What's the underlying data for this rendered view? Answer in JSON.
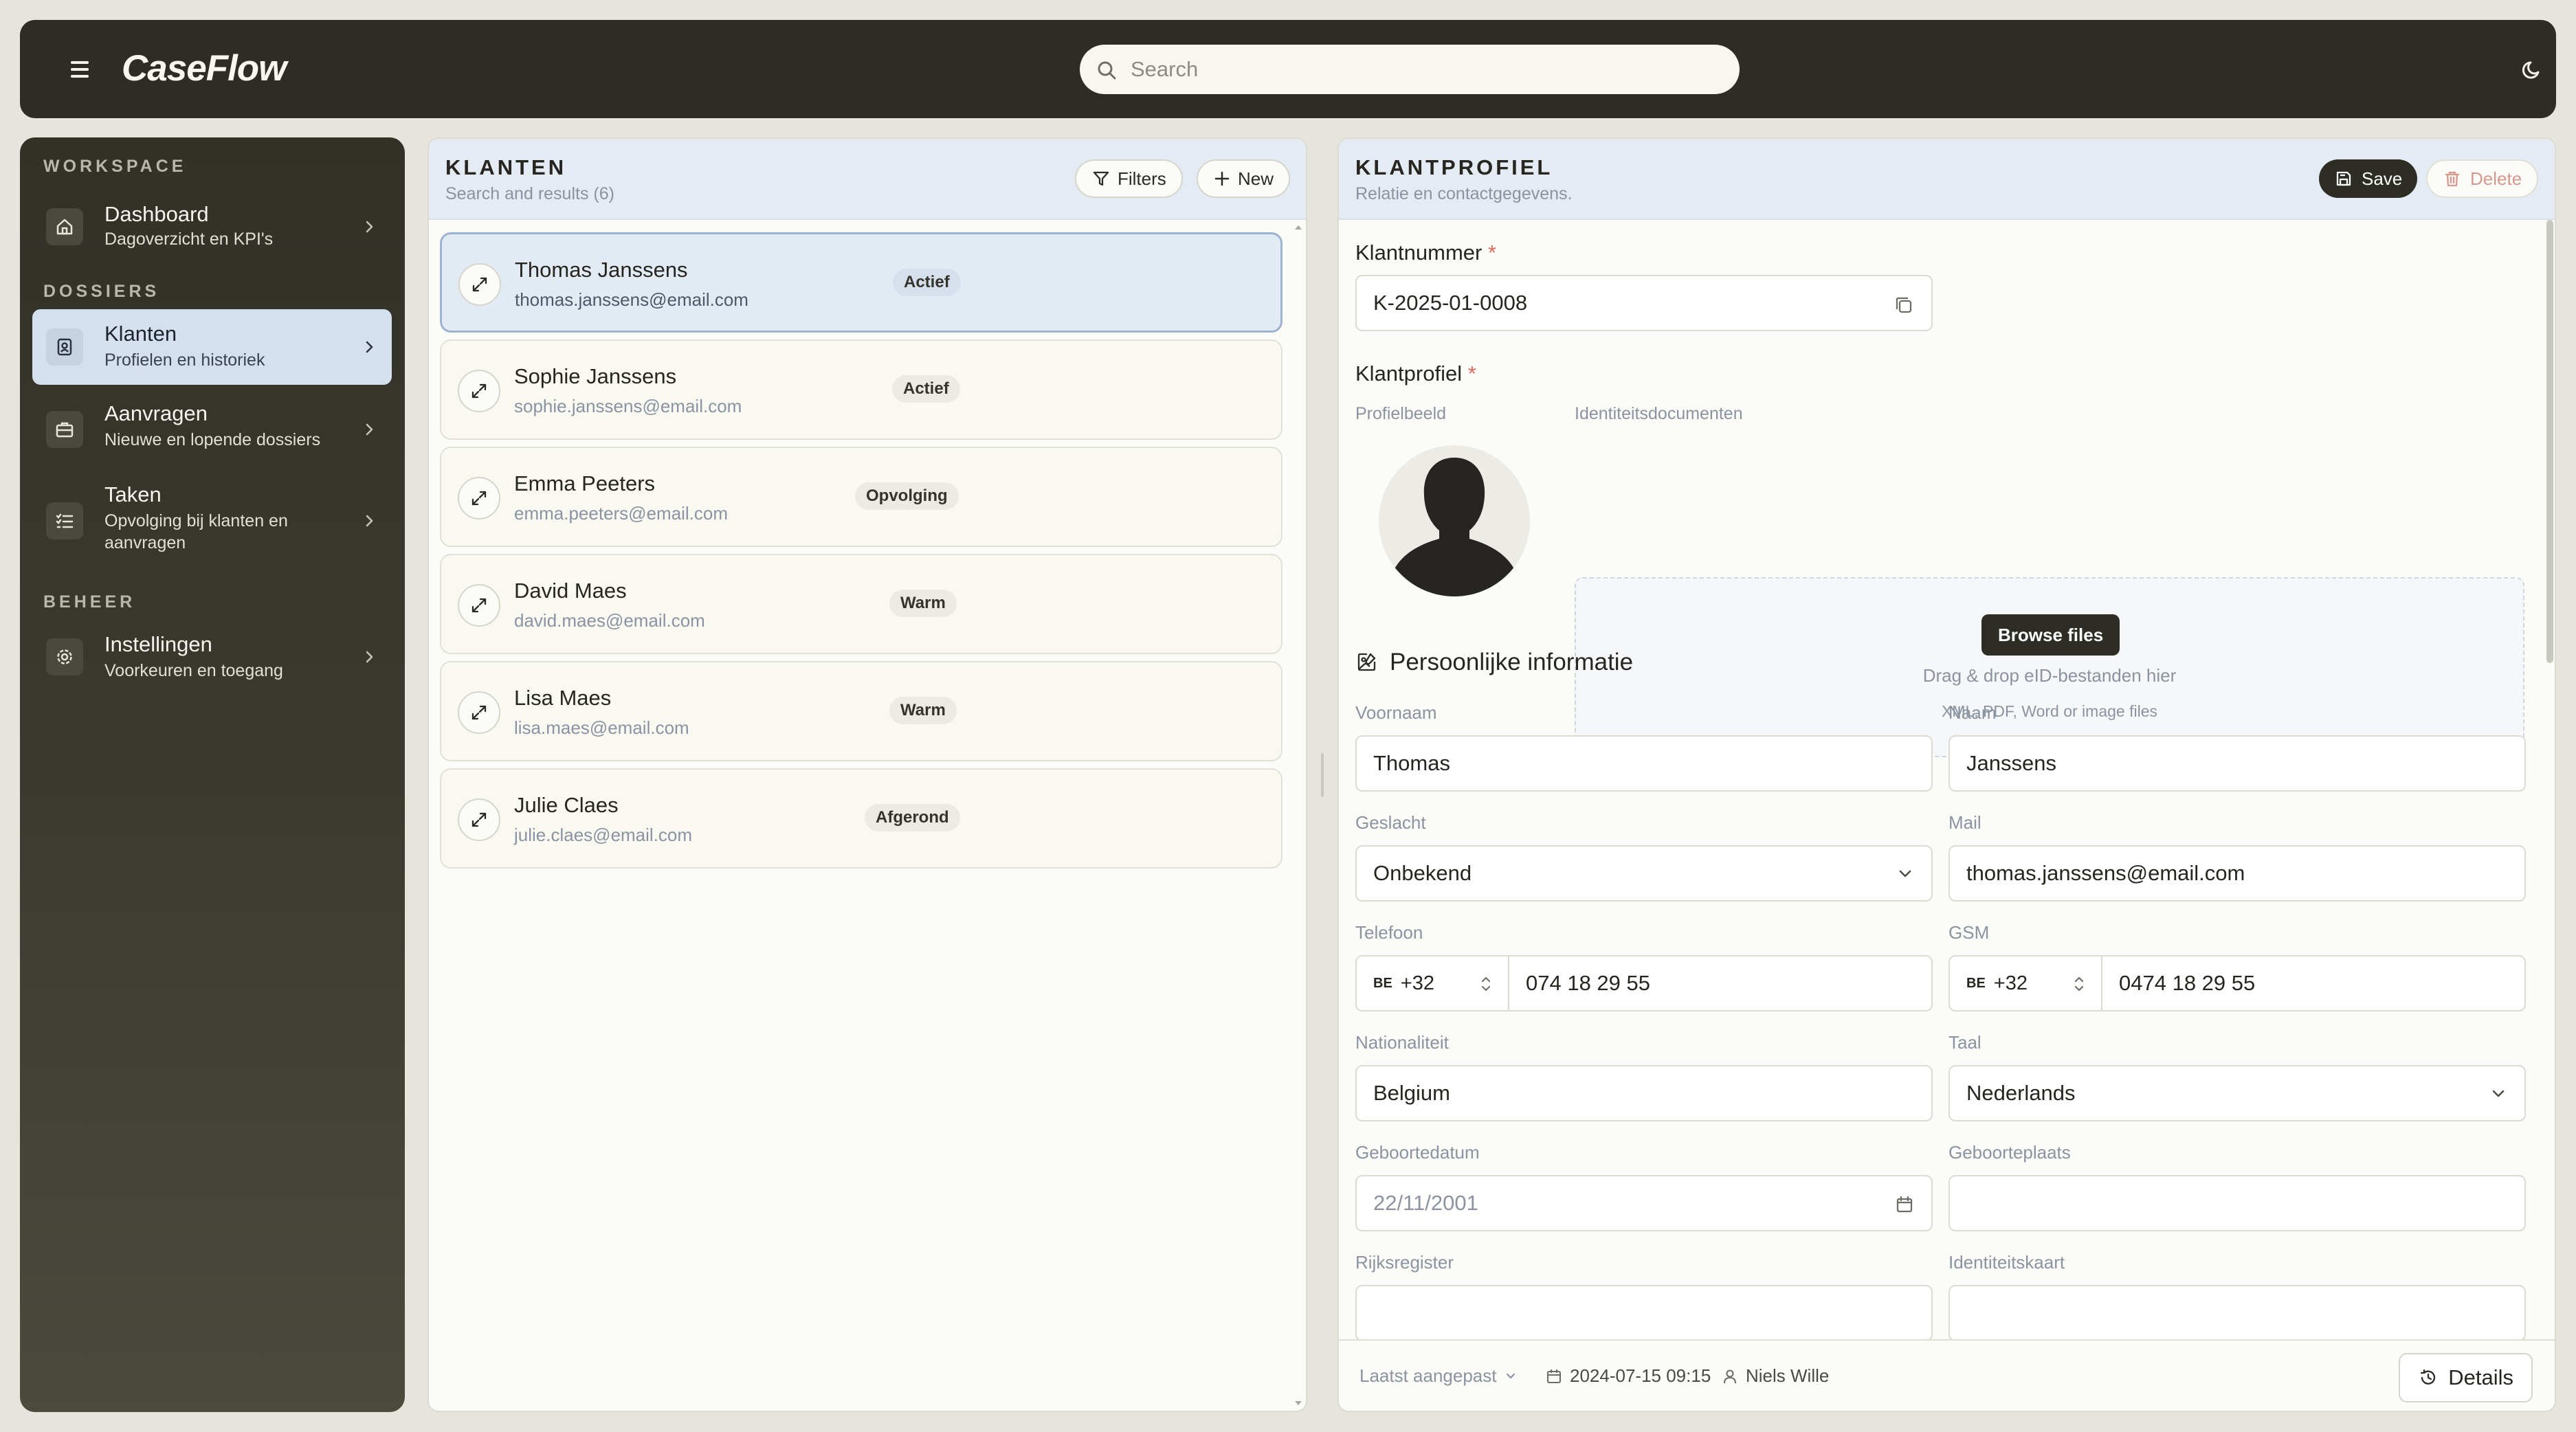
{
  "app": {
    "name": "CaseFlow"
  },
  "search": {
    "placeholder": "Search"
  },
  "sidebar": {
    "sections": [
      {
        "label": "WORKSPACE"
      },
      {
        "label": "DOSSIERS"
      },
      {
        "label": "BEHEER"
      }
    ],
    "items": [
      {
        "title": "Dashboard",
        "subtitle": "Dagoverzicht en KPI's",
        "icon": "home-icon",
        "active": false
      },
      {
        "title": "Klanten",
        "subtitle": "Profielen en historiek",
        "icon": "contact-icon",
        "active": true
      },
      {
        "title": "Aanvragen",
        "subtitle": "Nieuwe en lopende dossiers",
        "icon": "briefcase-icon",
        "active": false
      },
      {
        "title": "Taken",
        "subtitle": "Opvolging bij klanten en aanvragen",
        "icon": "tasks-icon",
        "active": false
      },
      {
        "title": "Instellingen",
        "subtitle": "Voorkeuren en toegang",
        "icon": "gear-icon",
        "active": false
      }
    ]
  },
  "list": {
    "title": "KLANTEN",
    "subtitle": "Search and results (6)",
    "filters_label": "Filters",
    "new_label": "New",
    "customers": [
      {
        "name": "Thomas Janssens",
        "email": "thomas.janssens@email.com",
        "status": "Actief",
        "active": true
      },
      {
        "name": "Sophie Janssens",
        "email": "sophie.janssens@email.com",
        "status": "Actief",
        "active": false
      },
      {
        "name": "Emma Peeters",
        "email": "emma.peeters@email.com",
        "status": "Opvolging",
        "active": false
      },
      {
        "name": "David Maes",
        "email": "david.maes@email.com",
        "status": "Warm",
        "active": false
      },
      {
        "name": "Lisa Maes",
        "email": "lisa.maes@email.com",
        "status": "Warm",
        "active": false
      },
      {
        "name": "Julie Claes",
        "email": "julie.claes@email.com",
        "status": "Afgerond",
        "active": false
      }
    ]
  },
  "profile": {
    "title": "KLANTPROFIEL",
    "subtitle": "Relatie en contactgegevens.",
    "save_label": "Save",
    "delete_label": "Delete",
    "klantnummer_label": "Klantnummer",
    "klantnummer_value": "K-2025-01-0008",
    "klantprofiel_label": "Klantprofiel",
    "profielbeeld_label": "Profielbeeld",
    "identiteit_label": "Identiteitsdocumenten",
    "browse_label": "Browse files",
    "drop_text": "Drag & drop eID-bestanden hier",
    "drop_sub": "XML, PDF, Word or image files",
    "section_title": "Persoonlijke informatie",
    "fields": {
      "voornaam": {
        "label": "Voornaam",
        "value": "Thomas"
      },
      "naam": {
        "label": "Naam",
        "value": "Janssens"
      },
      "geslacht": {
        "label": "Geslacht",
        "value": "Onbekend"
      },
      "mail": {
        "label": "Mail",
        "value": "thomas.janssens@email.com"
      },
      "telefoon": {
        "label": "Telefoon",
        "country": "BE",
        "prefix": "+32",
        "value": "074 18 29 55"
      },
      "gsm": {
        "label": "GSM",
        "country": "BE",
        "prefix": "+32",
        "value": "0474 18 29 55"
      },
      "nationaliteit": {
        "label": "Nationaliteit",
        "value": "Belgium"
      },
      "taal": {
        "label": "Taal",
        "value": "Nederlands"
      },
      "geboortedatum": {
        "label": "Geboortedatum",
        "placeholder": "22/11/2001"
      },
      "geboorteplaats": {
        "label": "Geboorteplaats",
        "value": ""
      },
      "rijksregister": {
        "label": "Rijksregister",
        "value": ""
      },
      "identiteitskaart": {
        "label": "Identiteitskaart",
        "value": ""
      }
    },
    "footer": {
      "modified_label": "Laatst aangepast",
      "modified_date": "2024-07-15 09:15",
      "modified_by": "Niels Wille",
      "details_label": "Details"
    }
  },
  "colors": {
    "topbar": "#2e2d25",
    "accent_active": "#d5e0ee",
    "required": "#e06b5e",
    "delete": "#d59a8d"
  }
}
